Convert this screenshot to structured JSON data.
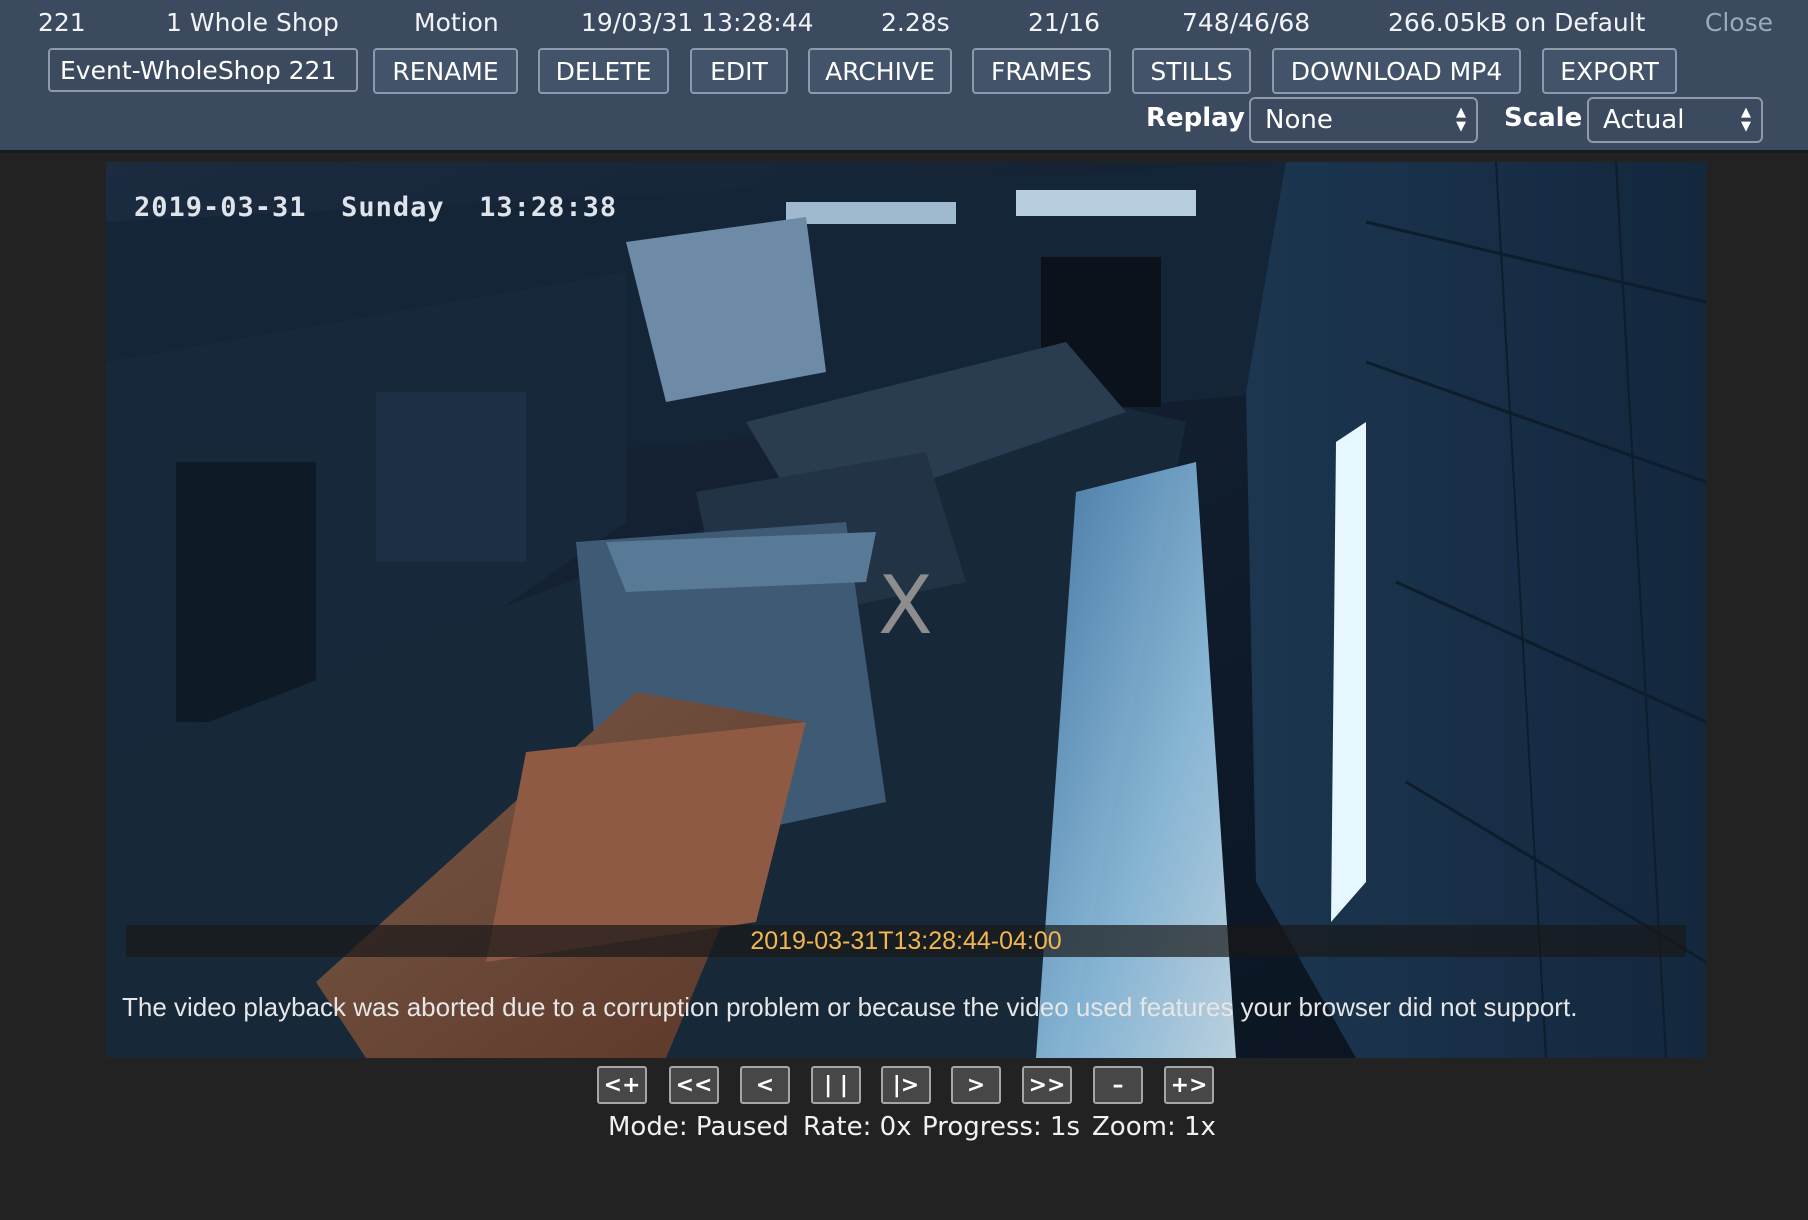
{
  "header": {
    "event_id": "221",
    "monitor": "1 Whole Shop",
    "cause": "Motion",
    "datetime": "19/03/31 13:28:44",
    "duration": "2.28s",
    "frames": "21/16",
    "scores": "748/46/68",
    "storage": "266.05kB on Default",
    "close_label": "Close"
  },
  "toolbar": {
    "event_name_value": "Event-WholeShop 221",
    "rename_label": "RENAME",
    "delete_label": "DELETE",
    "edit_label": "EDIT",
    "archive_label": "ARCHIVE",
    "frames_label": "FRAMES",
    "stills_label": "STILLS",
    "download_label": "DOWNLOAD MP4",
    "export_label": "EXPORT"
  },
  "options": {
    "replay_label": "Replay",
    "replay_value": "None",
    "scale_label": "Scale",
    "scale_value": "Actual"
  },
  "video": {
    "osd_text": "2019-03-31  Sunday  13:28:38",
    "close_mark": "X",
    "timestamp": "2019-03-31T13:28:44-04:00",
    "error_message": "The video playback was aborted due to a corruption problem or because the video used features your browser did not support."
  },
  "controls": {
    "buttons": [
      "<+",
      "<<",
      "<",
      "| |",
      "|>",
      ">",
      ">>",
      "–",
      "+>"
    ],
    "mode": "Mode: Paused",
    "rate": "Rate: 0x",
    "progress": "Progress: 1s",
    "zoom": "Zoom: 1x"
  },
  "colors": {
    "header_bg": "#3b4a5e",
    "page_bg": "#222222",
    "timestamp": "#f4b74f"
  }
}
